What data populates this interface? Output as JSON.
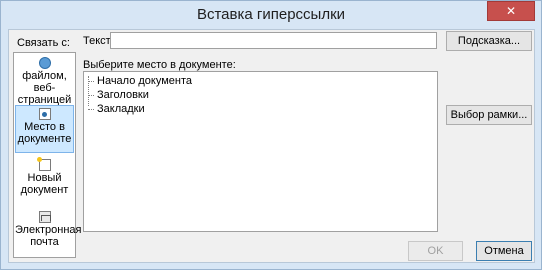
{
  "dialog": {
    "title": "Вставка гиперссылки",
    "close_symbol": "✕",
    "link_to_label": "Связать с:",
    "text_label": "Текст:",
    "text_value": "",
    "hint_button": "Подсказка...",
    "select_place_label": "Выберите место в документе:",
    "frame_button": "Выбор рамки...",
    "ok_button": "OK",
    "cancel_button": "Отмена"
  },
  "sidebar": {
    "items": [
      {
        "label": "файлом, веб-страницей",
        "icon": "web-page-icon",
        "selected": false
      },
      {
        "label": "Место в документе",
        "icon": "place-in-document-icon",
        "selected": true
      },
      {
        "label": "Новый документ",
        "icon": "new-document-icon",
        "selected": false
      },
      {
        "label": "Электронная почта",
        "icon": "email-icon",
        "selected": false
      }
    ]
  },
  "tree": {
    "items": [
      {
        "label": "Начало документа"
      },
      {
        "label": "Заголовки"
      },
      {
        "label": "Закладки"
      }
    ]
  }
}
